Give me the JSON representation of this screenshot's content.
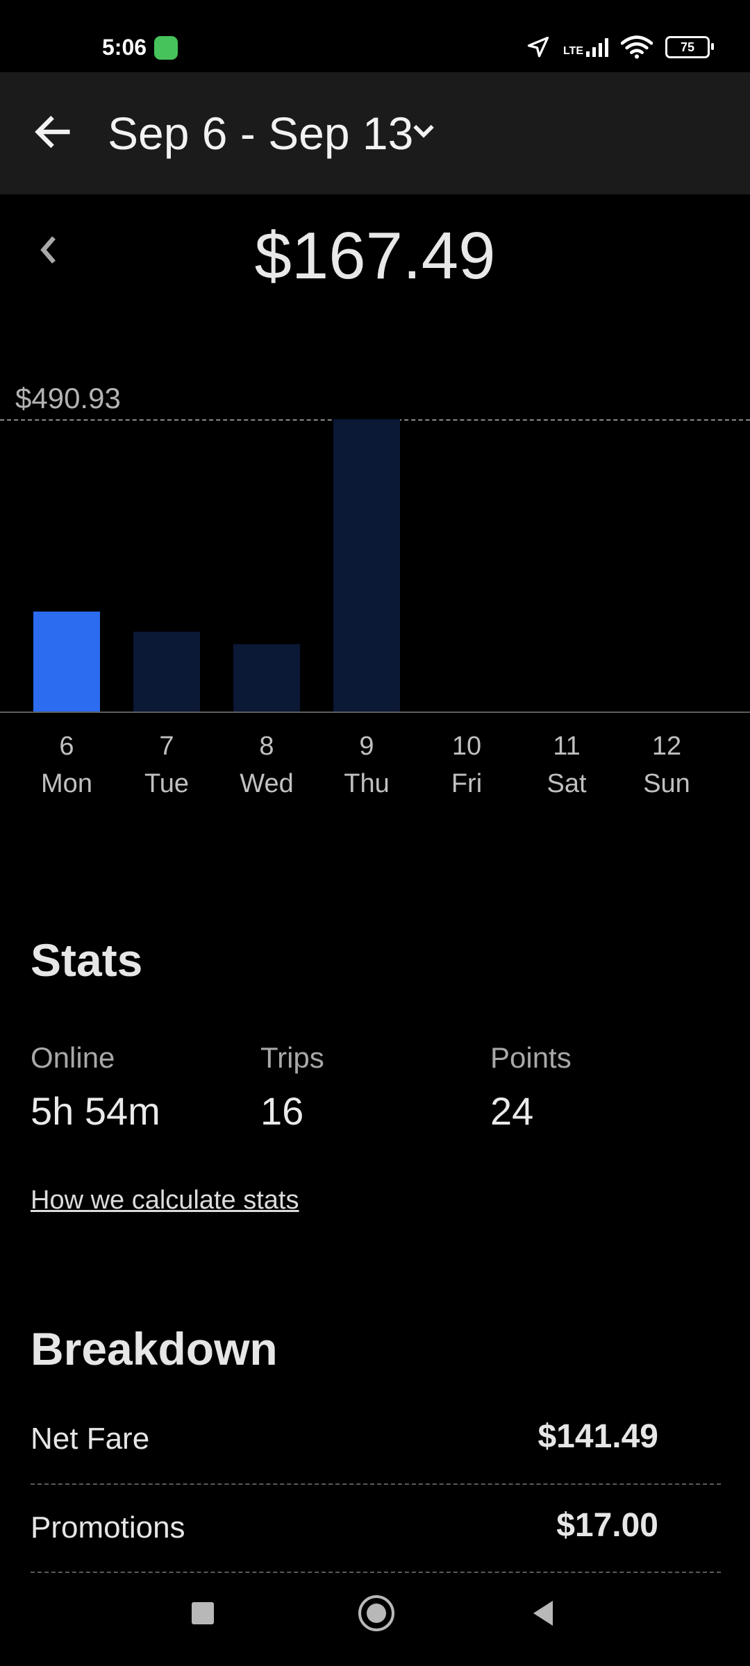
{
  "status_bar": {
    "time": "5:06",
    "network": "LTE",
    "battery": "75"
  },
  "header": {
    "date_range": "Sep 6 - Sep 13"
  },
  "summary": {
    "total": "$167.49"
  },
  "chart_data": {
    "type": "bar",
    "max_label": "$490.93",
    "ylim": [
      0,
      490.93
    ],
    "categories": [
      {
        "day": "6",
        "weekday": "Mon"
      },
      {
        "day": "7",
        "weekday": "Tue"
      },
      {
        "day": "8",
        "weekday": "Wed"
      },
      {
        "day": "9",
        "weekday": "Thu"
      },
      {
        "day": "10",
        "weekday": "Fri"
      },
      {
        "day": "11",
        "weekday": "Sat"
      },
      {
        "day": "12",
        "weekday": "Sun"
      }
    ],
    "values": [
      167.49,
      134,
      113,
      490.93,
      0,
      0,
      0
    ],
    "selected_index": 0,
    "colors": {
      "selected": "#2b6cf0",
      "normal": "#0b1836"
    }
  },
  "stats": {
    "title": "Stats",
    "items": [
      {
        "label": "Online",
        "value": "5h 54m"
      },
      {
        "label": "Trips",
        "value": "16"
      },
      {
        "label": "Points",
        "value": "24"
      }
    ],
    "link": "How we calculate stats"
  },
  "breakdown": {
    "title": "Breakdown",
    "rows": [
      {
        "label": "Net Fare",
        "value": "$141.49"
      },
      {
        "label": "Promotions",
        "value": "$17.00"
      }
    ]
  }
}
